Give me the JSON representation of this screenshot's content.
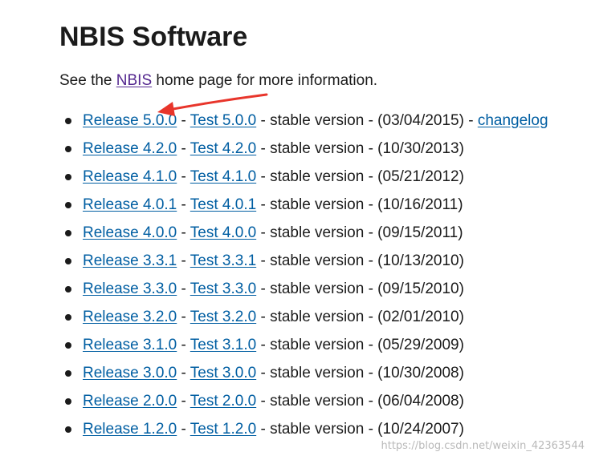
{
  "page": {
    "title": "NBIS Software",
    "intro": {
      "prefix": "See the ",
      "link": "NBIS",
      "suffix": " home page for more information."
    },
    "releases": [
      {
        "release": "Release 5.0.0",
        "test": "Test 5.0.0",
        "desc": " - stable version - (03/04/2015) - ",
        "changelog": "changelog"
      },
      {
        "release": "Release 4.2.0",
        "test": "Test 4.2.0",
        "desc": " - stable version - (10/30/2013)"
      },
      {
        "release": "Release 4.1.0",
        "test": "Test 4.1.0",
        "desc": " - stable version - (05/21/2012)"
      },
      {
        "release": "Release 4.0.1",
        "test": "Test 4.0.1",
        "desc": " - stable version - (10/16/2011)"
      },
      {
        "release": "Release 4.0.0",
        "test": "Test 4.0.0",
        "desc": " - stable version - (09/15/2011)"
      },
      {
        "release": "Release 3.3.1",
        "test": "Test 3.3.1",
        "desc": " - stable version - (10/13/2010)"
      },
      {
        "release": "Release 3.3.0",
        "test": "Test 3.3.0",
        "desc": " - stable version - (09/15/2010)"
      },
      {
        "release": "Release 3.2.0",
        "test": "Test 3.2.0",
        "desc": " - stable version - (02/01/2010)"
      },
      {
        "release": "Release 3.1.0",
        "test": "Test 3.1.0",
        "desc": " - stable version - (05/29/2009)"
      },
      {
        "release": "Release 3.0.0",
        "test": "Test 3.0.0",
        "desc": " - stable version - (10/30/2008)"
      },
      {
        "release": "Release 2.0.0",
        "test": "Test 2.0.0",
        "desc": " - stable version - (06/04/2008)"
      },
      {
        "release": "Release 1.2.0",
        "test": "Test 1.2.0",
        "desc": " - stable version - (10/24/2007)"
      }
    ],
    "separator": " - "
  },
  "watermark": "https://blog.csdn.net/weixin_42363544",
  "colors": {
    "link": "#005ea2",
    "visited_link": "#54278f",
    "text": "#1b1b1b",
    "annotation_arrow": "#e8352b"
  },
  "icons": {
    "annotation": "red-arrow-icon",
    "bullet": "bullet-dot-icon"
  }
}
